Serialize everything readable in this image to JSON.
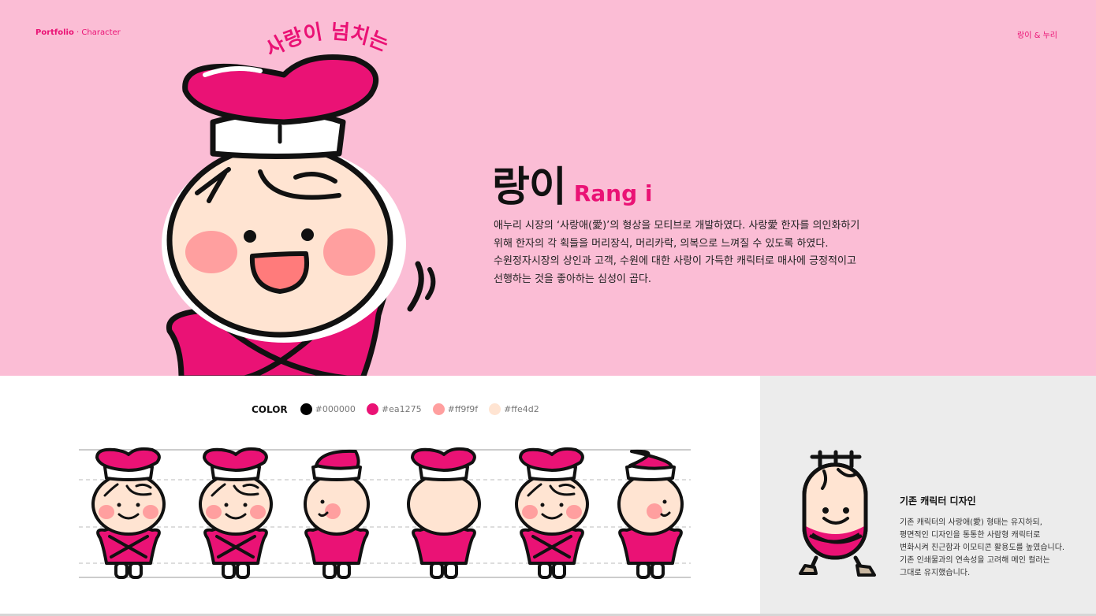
{
  "header": {
    "brand": "Portfolio",
    "separator": " · ",
    "section": "Character",
    "right_link": "랑이 & 누리"
  },
  "hero": {
    "tagline": "사랑이 넘치는",
    "name_ko": "랑이",
    "name_en": "Rang i",
    "description": [
      "애누리 시장의 ‘사랑애(愛)’의 형상을 모티브로 개발하였다. 사랑愛 한자를 의인화하기",
      "위해 한자의 각 획들을 머리장식, 머리카락, 의복으로 느껴질 수 있도록 하였다.",
      "수원정자시장의 상인과 고객, 수원에 대한 사랑이 가득한 캐릭터로 매사에 긍정적이고",
      "선행하는 것을 좋아하는 심성이 곱다."
    ]
  },
  "palette": {
    "label": "COLOR",
    "colors": [
      {
        "hex": "#000000",
        "label": "#000000"
      },
      {
        "hex": "#ea1275",
        "label": "#ea1275"
      },
      {
        "hex": "#ff9f9f",
        "label": "#ff9f9f"
      },
      {
        "hex": "#ffe4d2",
        "label": "#ffe4d2"
      }
    ]
  },
  "turnaround": {
    "views": [
      "front",
      "front-alt",
      "side-left",
      "back",
      "three-quarter",
      "side-right"
    ]
  },
  "original": {
    "title": "기존 캐릭터 디자인",
    "description": [
      "기존 캐릭터의 사랑애(愛) 형태는 유지하되,",
      "평면적인 디자인을 통통한 사람형 캐릭터로",
      "변화시켜 친근함과 이모티콘 활용도를 높였습니다.",
      "기존 인쇄물과의 연속성을 고려해 메인 컬러는",
      "그대로 유지했습니다."
    ]
  },
  "colors": {
    "hero_bg": "#fbbdd5",
    "accent": "#ea1275",
    "panel_bg": "#ececec"
  }
}
